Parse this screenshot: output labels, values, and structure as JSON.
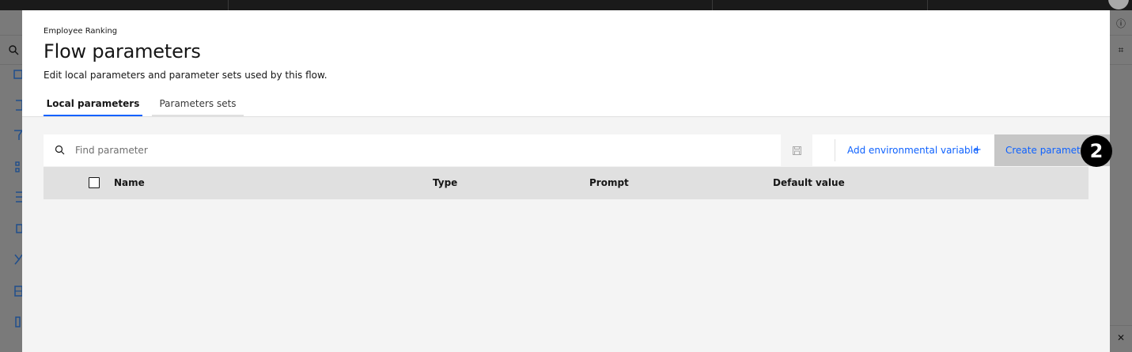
{
  "modal": {
    "eyebrow": "Employee Ranking",
    "title": "Flow parameters",
    "subtitle": "Edit local parameters and parameter sets used by this flow."
  },
  "tabs": [
    {
      "label": "Local parameters",
      "active": true
    },
    {
      "label": "Parameters sets",
      "active": false
    }
  ],
  "toolbar": {
    "search_placeholder": "Find parameter",
    "search_value": "",
    "save_icon": "save-icon",
    "add_env_label": "Add environmental variable",
    "add_env_icon": "plus-icon",
    "create_label": "Create parameter",
    "create_icon": "plus-icon"
  },
  "table": {
    "columns": [
      "Name",
      "Type",
      "Prompt",
      "Default value"
    ],
    "rows": []
  },
  "badge": {
    "text": "2"
  },
  "colors": {
    "accent": "#0f62fe",
    "header_bg": "#e0e0e0",
    "modal_bg": "#f4f4f4",
    "create_bg": "#c6c6c6"
  }
}
